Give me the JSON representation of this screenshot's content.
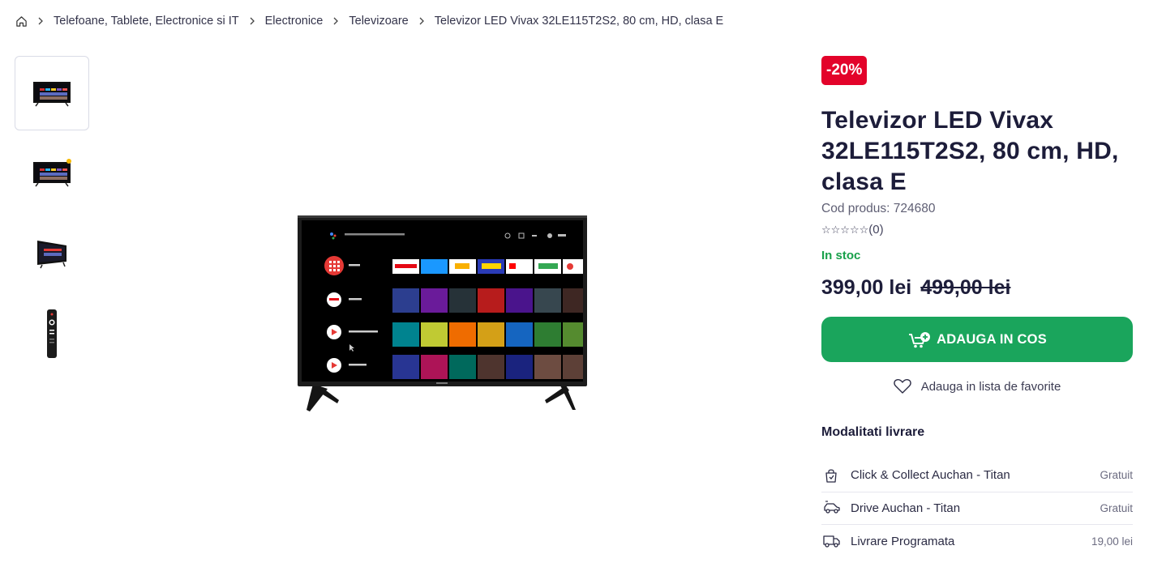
{
  "breadcrumb": {
    "home_icon": "home-icon",
    "items": [
      "Telefoane, Tablete, Electronice si IT",
      "Electronice",
      "Televizoare"
    ],
    "current": "Televizor LED Vivax 32LE115T2S2, 80 cm, HD, clasa E"
  },
  "gallery": {
    "thumbnails": [
      "tv-front",
      "tv-front-badge",
      "tv-angle",
      "remote-control"
    ],
    "active_index": 0
  },
  "product": {
    "discount_badge": "-20%",
    "title": "Televizor LED Vivax 32LE115T2S2, 80 cm, HD, clasa E",
    "sku": "Cod produs: 724680",
    "rating_stars": "☆☆☆☆☆",
    "rating_count": "(0)",
    "stock": "In stoc",
    "price": "399,00 lei",
    "old_price": "499,00 lei",
    "add_to_cart_label": "ADAUGA IN COS",
    "favorite_label": "Adauga in lista de favorite"
  },
  "delivery": {
    "title": "Modalitati livrare",
    "options": [
      {
        "icon": "click-collect-icon",
        "name": "Click & Collect Auchan - Titan",
        "price": "Gratuit"
      },
      {
        "icon": "drive-car-icon",
        "name": "Drive Auchan - Titan",
        "price": "Gratuit"
      },
      {
        "icon": "delivery-truck-icon",
        "name": "Livrare Programata",
        "price": "19,00 lei"
      }
    ]
  },
  "colors": {
    "discount": "#e3032a",
    "add_button": "#1aa55c",
    "stock": "#18a04a",
    "text": "#1d1d3a"
  }
}
